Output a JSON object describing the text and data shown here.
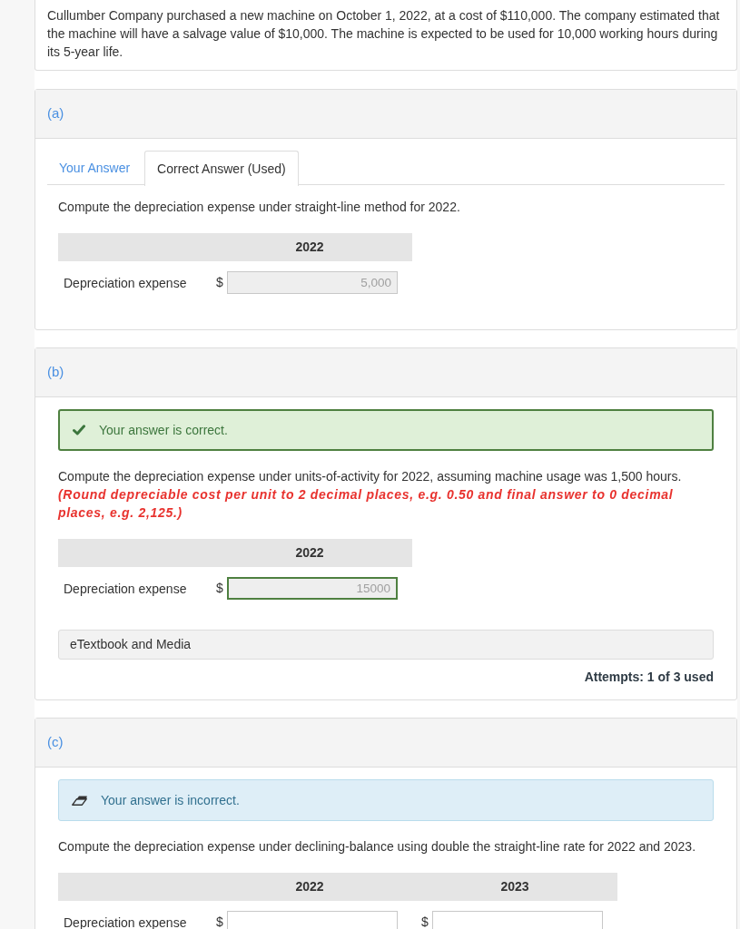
{
  "intro": "Cullumber Company purchased a new machine on October 1, 2022, at a cost of $110,000. The company estimated that the machine will have a salvage value of $10,000. The machine is expected to be used for 10,000 working hours during its 5-year life.",
  "parts": [
    {
      "label": "(a)",
      "tabs": [
        {
          "label": "Your Answer",
          "selected": false
        },
        {
          "label": "Correct Answer (Used)",
          "selected": true
        }
      ],
      "question": "Compute the depreciation expense under straight-line method for 2022.",
      "table": {
        "columns": [
          "2022"
        ],
        "rows": [
          {
            "label": "Depreciation expense",
            "cells": [
              {
                "currency": "$",
                "value": "5,000",
                "disabled": true,
                "correct": false
              }
            ]
          }
        ]
      }
    },
    {
      "label": "(b)",
      "alert": {
        "kind": "correct",
        "text": "Your answer is correct."
      },
      "question": "Compute the depreciation expense under units-of-activity for 2022, assuming machine usage was 1,500 hours.",
      "instruction": "(Round depreciable cost per unit to 2 decimal places, e.g. 0.50 and final answer to 0 decimal places, e.g. 2,125.)",
      "table": {
        "columns": [
          "2022"
        ],
        "rows": [
          {
            "label": "Depreciation expense",
            "cells": [
              {
                "currency": "$",
                "value": "15000",
                "disabled": true,
                "correct": true
              }
            ]
          }
        ]
      },
      "resources": "eTextbook and Media",
      "attempts": "Attempts: 1 of 3 used"
    },
    {
      "label": "(c)",
      "alert": {
        "kind": "incorrect",
        "text": "Your answer is incorrect."
      },
      "question": "Compute the depreciation expense under declining-balance using double the straight-line rate for 2022 and 2023.",
      "table": {
        "columns": [
          "2022",
          "2023"
        ],
        "rows": [
          {
            "label": "Depreciation expense",
            "cells": [
              {
                "currency": "$",
                "disabled": false,
                "correct": false
              },
              {
                "currency": "$",
                "disabled": false,
                "correct": false
              }
            ]
          }
        ]
      }
    }
  ]
}
